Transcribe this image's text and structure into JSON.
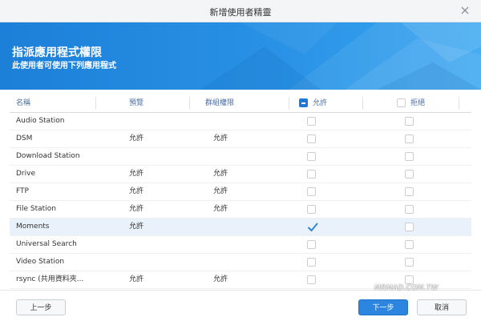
{
  "dialog": {
    "title": "新增使用者精靈"
  },
  "banner": {
    "title": "指派應用程式權限",
    "subtitle": "此使用者可使用下列應用程式"
  },
  "table": {
    "headers": {
      "name": "名稱",
      "preview": "預覽",
      "group": "群組權限",
      "allow": "允許",
      "deny": "拒絕"
    },
    "allow_header_state": "partial",
    "rows": [
      {
        "name": "Audio Station",
        "preview": "",
        "group": "",
        "allow": false,
        "deny": false
      },
      {
        "name": "DSM",
        "preview": "允許",
        "group": "允許",
        "allow": false,
        "deny": false
      },
      {
        "name": "Download Station",
        "preview": "",
        "group": "",
        "allow": false,
        "deny": false
      },
      {
        "name": "Drive",
        "preview": "允許",
        "group": "允許",
        "allow": false,
        "deny": false
      },
      {
        "name": "FTP",
        "preview": "允許",
        "group": "允許",
        "allow": false,
        "deny": false
      },
      {
        "name": "File Station",
        "preview": "允許",
        "group": "允許",
        "allow": false,
        "deny": false
      },
      {
        "name": "Moments",
        "preview": "允許",
        "group": "",
        "allow": true,
        "deny": false,
        "selected": true
      },
      {
        "name": "Universal Search",
        "preview": "",
        "group": "",
        "allow": false,
        "deny": false
      },
      {
        "name": "Video Station",
        "preview": "",
        "group": "",
        "allow": false,
        "deny": false
      },
      {
        "name": "rsync (共用資料夾...",
        "preview": "允許",
        "group": "允許",
        "allow": false,
        "deny": false
      }
    ]
  },
  "footer": {
    "back_label": "上一步",
    "next_label": "下一步",
    "cancel_label": "取消"
  },
  "watermark": "MRMAD.COM.TW",
  "colors": {
    "accent": "#2c86e0",
    "banner": "#1c7fd8",
    "header_text": "#4a6fa5",
    "selected_row": "#e9f2fb"
  },
  "icons": {
    "close": "close-icon",
    "check": "checkmark-icon"
  }
}
